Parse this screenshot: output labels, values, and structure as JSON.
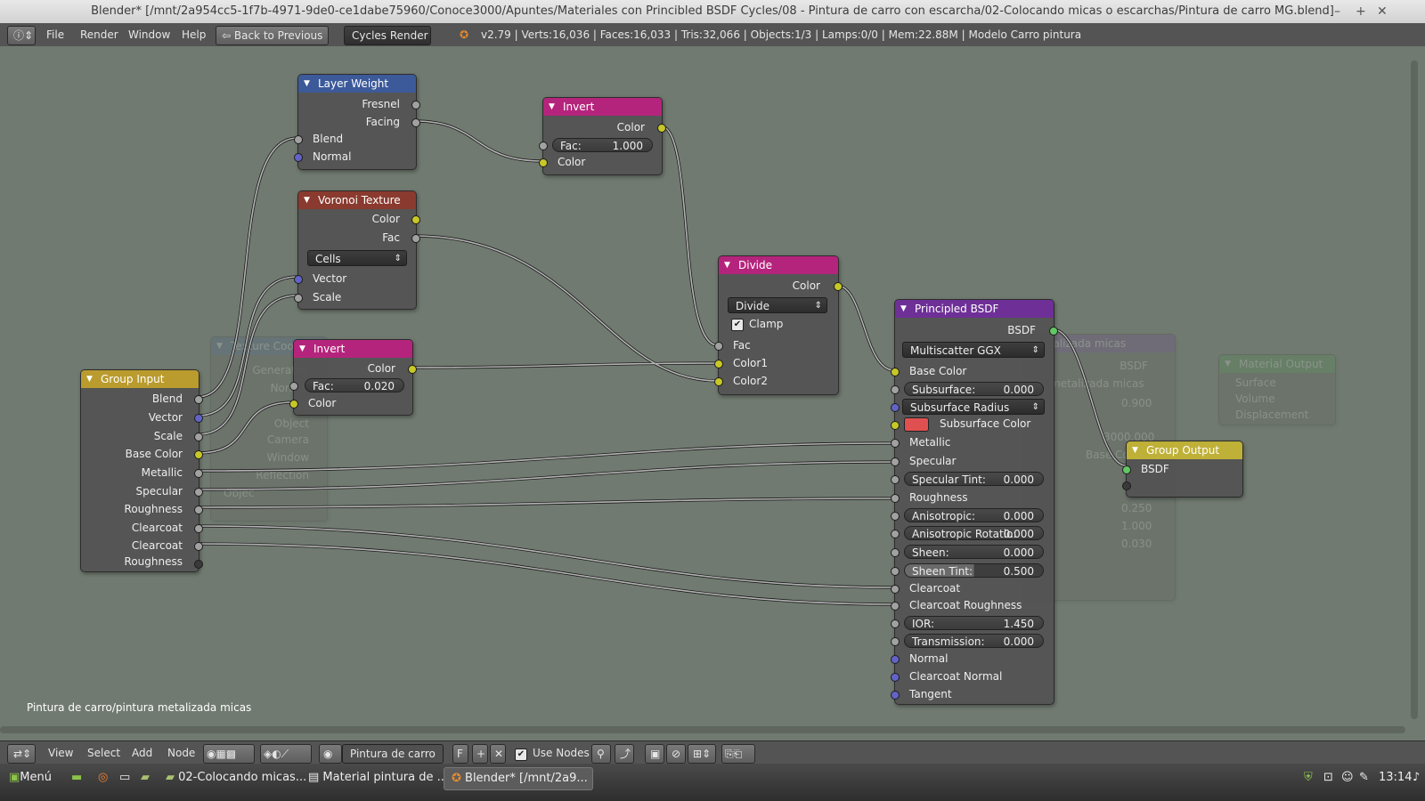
{
  "window": {
    "title": "Blender* [/mnt/2a954cc5-1f7b-4971-9de0-ce1dabe75960/Conoce3000/Apuntes/Materiales con Princibled BSDF Cycles/08 - Pintura de carro con escarcha/02-Colocando micas o escarchas/Pintura de carro MG.blend]",
    "controls": [
      "–",
      "+",
      "✕"
    ]
  },
  "infobar": {
    "menu": [
      "File",
      "Render",
      "Window",
      "Help"
    ],
    "back_button": "Back to Previous",
    "engine": "Cycles Render",
    "stats": "v2.79 | Verts:16,036 | Faces:16,033 | Tris:32,066 | Objects:1/3 | Lamps:0/0 | Mem:22.88M | Modelo Carro pintura"
  },
  "nodes": {
    "layer_weight": {
      "title": "Layer Weight",
      "outputs": [
        "Fresnel",
        "Facing"
      ],
      "inputs": [
        "Blend",
        "Normal"
      ]
    },
    "invert_top": {
      "title": "Invert",
      "output": "Color",
      "fac_label": "Fac:",
      "fac_value": "1.000",
      "input": "Color"
    },
    "voronoi": {
      "title": "Voronoi Texture",
      "outputs": [
        "Color",
        "Fac"
      ],
      "mode": "Cells",
      "inputs": [
        "Vector",
        "Scale"
      ]
    },
    "invert_mid": {
      "title": "Invert",
      "output": "Color",
      "fac_label": "Fac:",
      "fac_value": "0.020",
      "input": "Color"
    },
    "divide": {
      "title": "Divide",
      "output": "Color",
      "mode": "Divide",
      "clamp": "Clamp",
      "inputs": [
        "Fac",
        "Color1",
        "Color2"
      ]
    },
    "group_input": {
      "title": "Group Input",
      "outputs": [
        "Blend",
        "Vector",
        "Scale",
        "Base Color",
        "Metallic",
        "Specular",
        "Roughness",
        "Clearcoat",
        "Clearcoat Roughness"
      ]
    },
    "principled": {
      "title": "Principled BSDF",
      "output": "BSDF",
      "distribution": "Multiscatter GGX",
      "base_color": "Base Color",
      "subsurface_label": "Subsurface:",
      "subsurface_value": "0.000",
      "subsurface_radius": "Subsurface Radius",
      "subsurface_color": "Subsurface Color",
      "metallic": "Metallic",
      "specular": "Specular",
      "specular_tint_label": "Specular Tint:",
      "specular_tint_value": "0.000",
      "roughness": "Roughness",
      "anisotropic_label": "Anisotropic:",
      "anisotropic_value": "0.000",
      "anisotropic_rotation_label": "Anisotropic Rotatio:",
      "anisotropic_rotation_value": "0.000",
      "sheen_label": "Sheen:",
      "sheen_value": "0.000",
      "sheen_tint_label": "Sheen Tint:",
      "sheen_tint_value": "0.500",
      "clearcoat": "Clearcoat",
      "clearcoat_roughness": "Clearcoat Roughness",
      "ior_label": "IOR:",
      "ior_value": "1.450",
      "transmission_label": "Transmission:",
      "transmission_value": "0.000",
      "normal": "Normal",
      "clearcoat_normal": "Clearcoat Normal",
      "tangent": "Tangent"
    },
    "group_output": {
      "title": "Group Output",
      "input": "BSDF"
    },
    "ghost_texcoord": {
      "title": "Texture Coordi",
      "rows": [
        "Generated",
        "Normal",
        "UV",
        "Object",
        "Camera",
        "Window",
        "Reflection"
      ],
      "object_label": "Objec"
    },
    "ghost_material": {
      "title": "Material Output",
      "rows": [
        "Surface",
        "Volume",
        "Displacement"
      ]
    },
    "ghost_group": {
      "title": "...alizada micas",
      "rows": [
        "BSDF",
        "metalizada micas",
        "0.900",
        "3000.000",
        "Base Color",
        "0.250",
        "1.000",
        "0.030"
      ]
    }
  },
  "breadcrumb": "Pintura de carro/pintura metalizada micas",
  "bottombar": {
    "menu": [
      "View",
      "Select",
      "Add",
      "Node"
    ],
    "material_name": "Pintura de carro",
    "fake_user": "F",
    "use_nodes": "Use Nodes"
  },
  "taskbar": {
    "menu": "Menú",
    "items": [
      "02-Colocando micas...",
      "Material pintura de ...",
      "Blender* [/mnt/2a9..."
    ],
    "clock": "13:14"
  },
  "colors": {
    "canvas": "#707a70",
    "socket_grey": "#a1a1a1",
    "socket_yellow": "#c7c729",
    "socket_blue": "#6363c7",
    "socket_green": "#63c763",
    "subsurface_swatch": "#e05050"
  }
}
